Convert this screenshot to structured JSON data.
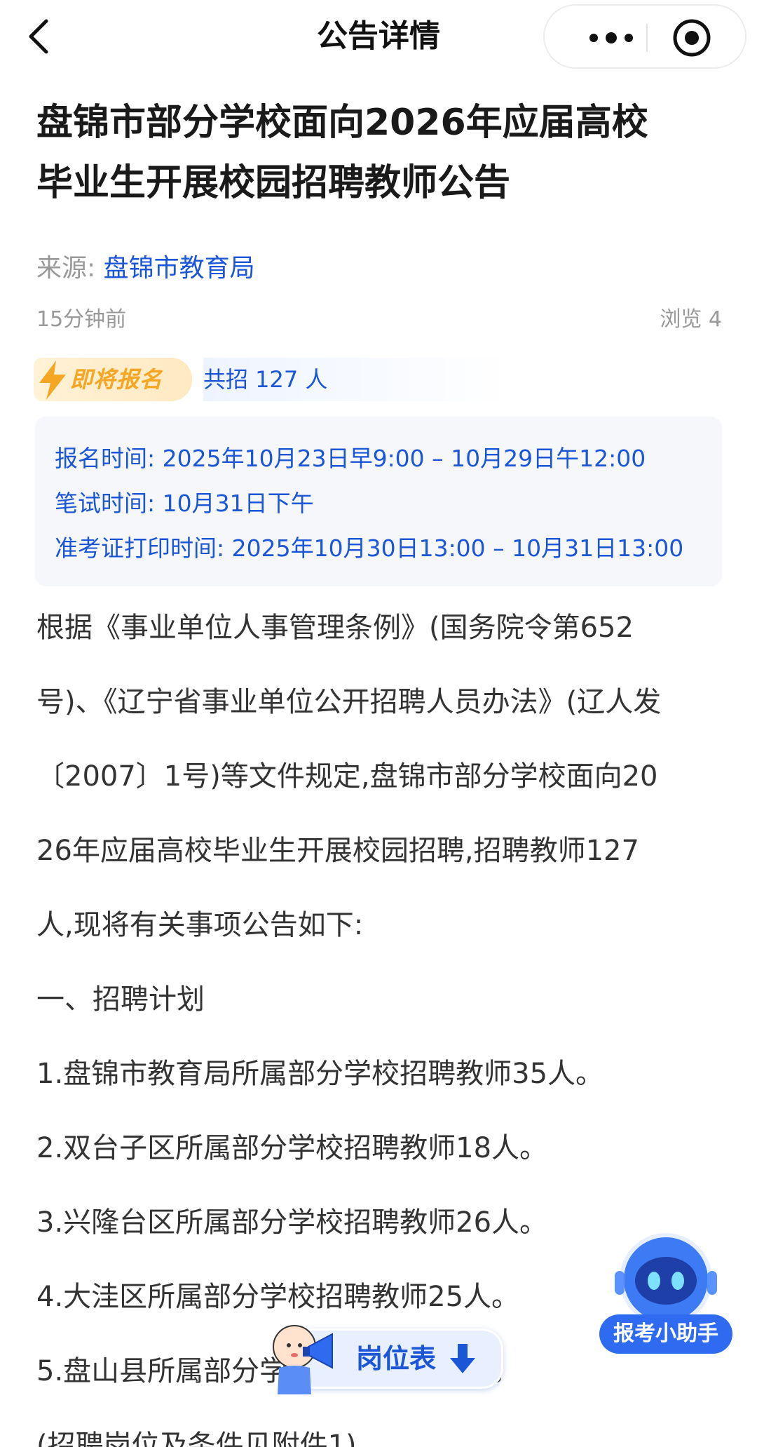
{
  "nav": {
    "title": "公告详情"
  },
  "article": {
    "title_line1": "盘锦市部分学校面向2026年应届高校",
    "title_line2": "毕业生开展校园招聘教师公告",
    "source_label": "来源:",
    "source_name": "盘锦市教育局",
    "time_ago": "15分钟前",
    "views": "浏览 4"
  },
  "status": {
    "badge": "即将报名",
    "quota": "共招 127 人"
  },
  "timeline": {
    "registration": "报名时间: 2025年10月23日早9:00 – 10月29日午12:00",
    "exam": "笔试时间: 10月31日下午",
    "admission_print": "准考证打印时间: 2025年10月30日13:00 – 10月31日13:00"
  },
  "body": {
    "lines": [
      "根据《事业单位人事管理条例》(国务院令第652",
      "号)、《辽宁省事业单位公开招聘人员办法》(辽人发",
      "〔2007〕1号)等文件规定,盘锦市部分学校面向20",
      "26年应届高校毕业生开展校园招聘,招聘教师127",
      "人,现将有关事项公告如下:",
      "一、招聘计划",
      "1.盘锦市教育局所属部分学校招聘教师35人。",
      "2.双台子区所属部分学校招聘教师18人。",
      "3.兴隆台区所属部分学校招聘教师26人。",
      "4.大洼区所属部分学校招聘教师25人。",
      "5.盘山县所属部分学校招聘教师23人。",
      "(招聘岗位及条件见附件1)"
    ]
  },
  "floating": {
    "assistant_label": "报考小助手",
    "jobs_label": "岗位表"
  },
  "colors": {
    "link_blue": "#1a56d6",
    "badge_orange": "#f5a623",
    "assistant_blue": "#2f6bf0"
  },
  "icons": {
    "back": "chevron-left-icon",
    "more": "more-dots-icon",
    "close": "target-circle-icon",
    "bolt": "lightning-icon",
    "arrow": "down-arrow-icon"
  }
}
